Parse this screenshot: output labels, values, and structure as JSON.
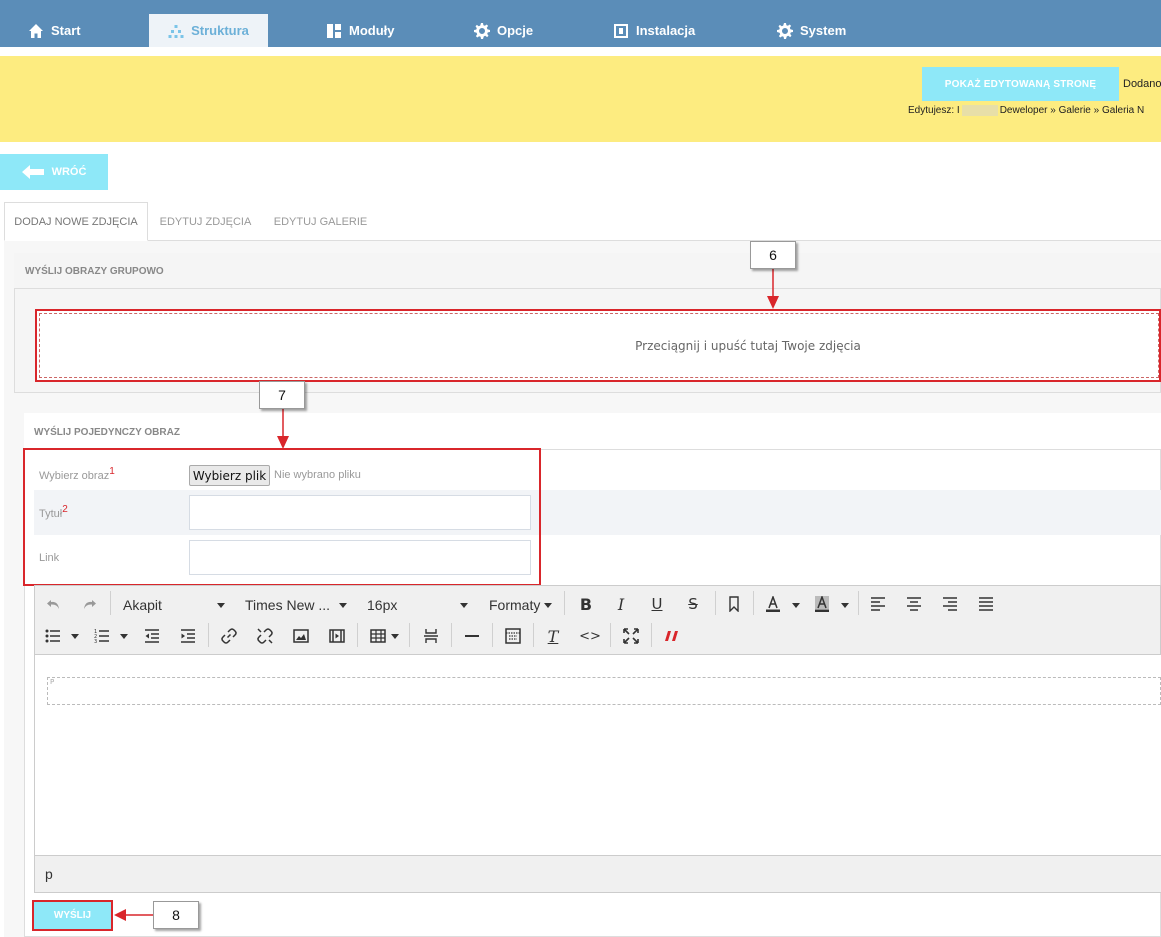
{
  "nav": {
    "items": [
      {
        "label": "Start",
        "icon": "home-icon"
      },
      {
        "label": "Struktura",
        "icon": "sitemap-icon",
        "active": true
      },
      {
        "label": "Moduły",
        "icon": "modules-icon"
      },
      {
        "label": "Opcje",
        "icon": "gear-icon"
      },
      {
        "label": "Instalacja",
        "icon": "install-icon"
      },
      {
        "label": "System",
        "icon": "gear-icon"
      }
    ]
  },
  "notice": {
    "show_page_label": "POKAŻ EDYTOWANĄ STRONĘ",
    "added_text": "Dodano",
    "editing_prefix": "Edytujesz: I",
    "editing_path": "Deweloper » Galerie » Galeria N"
  },
  "back_label": "WRÓĆ",
  "tabs": [
    {
      "label": "DODAJ NOWE ZDJĘCIA",
      "active": true
    },
    {
      "label": "EDYTUJ ZDJĘCIA"
    },
    {
      "label": "EDYTUJ GALERIE"
    }
  ],
  "group_upload": {
    "title": "WYŚLIJ OBRAZY GRUPOWO",
    "dropzone_text": "Przeciągnij i upuść tutaj Twoje zdjęcia"
  },
  "single_upload": {
    "title": "WYŚLIJ POJEDYNCZY OBRAZ",
    "image_label": "Wybierz obraz",
    "image_req": "1",
    "file_button": "Wybierz plik",
    "file_status": "Nie wybrano pliku",
    "title_label": "Tytuł",
    "title_req": "2",
    "title_value": "",
    "link_label": "Link",
    "link_value": ""
  },
  "editor": {
    "block_format": "Akapit",
    "font_family": "Times New ...",
    "font_size": "16px",
    "formats": "Formaty",
    "status_path": "p",
    "para_mark": "P"
  },
  "submit_label": "WYŚLIJ",
  "callouts": {
    "c6": "6",
    "c7": "7",
    "c8": "8"
  },
  "colors": {
    "nav": "#5b8db8",
    "notice": "#fdec80",
    "button": "#8ee8f8",
    "highlight": "#d9262b"
  }
}
